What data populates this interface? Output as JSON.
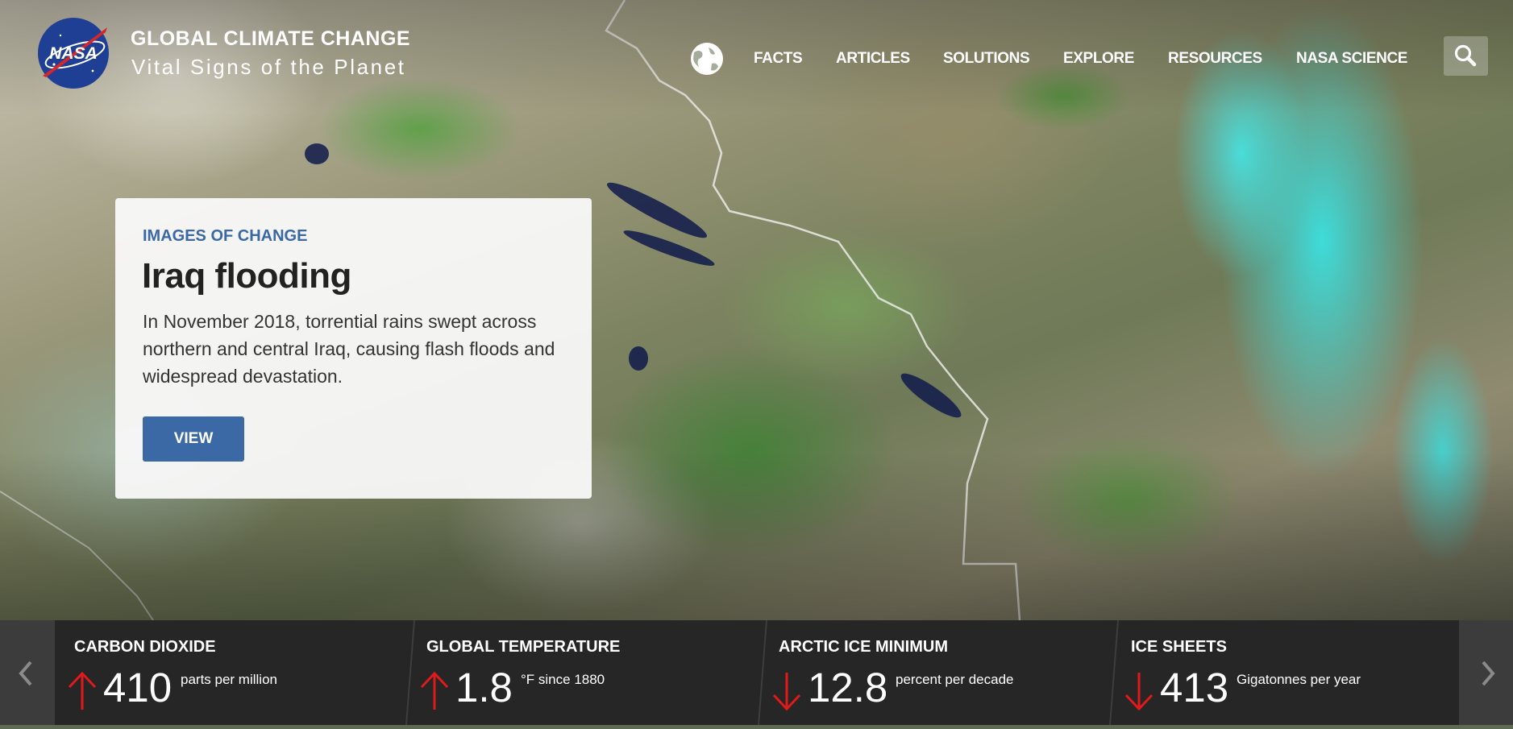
{
  "header": {
    "logo_text": "NASA",
    "title": "GLOBAL CLIMATE CHANGE",
    "subtitle": "Vital Signs of the Planet"
  },
  "nav": {
    "items": [
      {
        "label": "FACTS"
      },
      {
        "label": "ARTICLES"
      },
      {
        "label": "SOLUTIONS"
      },
      {
        "label": "EXPLORE"
      },
      {
        "label": "RESOURCES"
      },
      {
        "label": "NASA SCIENCE"
      }
    ]
  },
  "feature": {
    "eyebrow": "IMAGES OF CHANGE",
    "title": "Iraq flooding",
    "description": "In November 2018, torrential rains swept across northern and central Iraq, causing flash floods and widespread devastation.",
    "button_label": "VIEW"
  },
  "vitals": {
    "items": [
      {
        "label": "CARBON DIOXIDE",
        "trend": "up",
        "value": "410",
        "unit": "parts per million"
      },
      {
        "label": "GLOBAL TEMPERATURE",
        "trend": "up",
        "value": "1.8",
        "unit": "°F since 1880"
      },
      {
        "label": "ARCTIC ICE MINIMUM",
        "trend": "down",
        "value": "12.8",
        "unit": "percent per decade"
      },
      {
        "label": "ICE SHEETS",
        "trend": "down",
        "value": "413",
        "unit": "Gigatonnes per year"
      }
    ]
  },
  "colors": {
    "accent_blue": "#3b69a5",
    "trend_red": "#e0191c",
    "vitals_bg": "#262626"
  }
}
